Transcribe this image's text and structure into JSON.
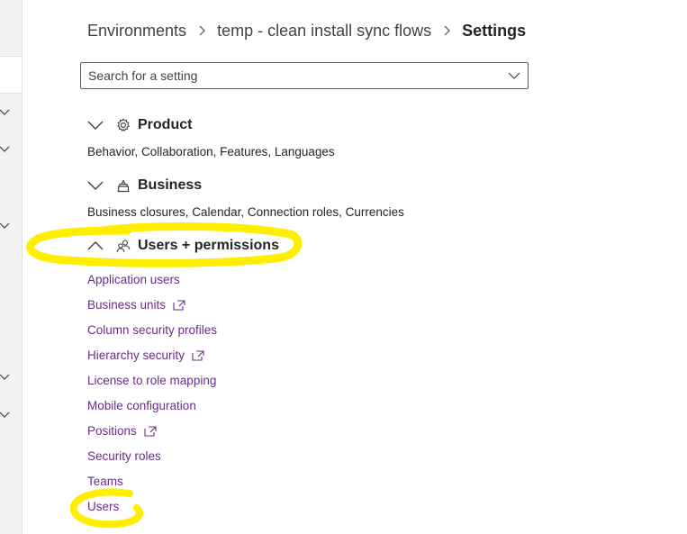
{
  "breadcrumb": {
    "items": [
      "Environments",
      "temp - clean install sync flows"
    ],
    "current": "Settings"
  },
  "search": {
    "placeholder": "Search for a setting",
    "value": ""
  },
  "sections": [
    {
      "title": "Product",
      "icon": "gear-icon",
      "expanded": false,
      "summary": "Behavior, Collaboration, Features, Languages"
    },
    {
      "title": "Business",
      "icon": "business-icon",
      "expanded": false,
      "summary": "Business closures, Calendar, Connection roles, Currencies"
    },
    {
      "title": "Users + permissions",
      "icon": "people-icon",
      "expanded": true
    }
  ],
  "user_links": [
    {
      "label": "Application users",
      "external": false
    },
    {
      "label": "Business units",
      "external": true
    },
    {
      "label": "Column security profiles",
      "external": false
    },
    {
      "label": "Hierarchy security",
      "external": true
    },
    {
      "label": "License to role mapping",
      "external": false
    },
    {
      "label": "Mobile configuration",
      "external": false
    },
    {
      "label": "Positions",
      "external": true
    },
    {
      "label": "Security roles",
      "external": false
    },
    {
      "label": "Teams",
      "external": false
    },
    {
      "label": "Users",
      "external": false
    }
  ],
  "colors": {
    "link": "#6b2c86",
    "highlight": "#ffee00",
    "text": "#242424"
  }
}
